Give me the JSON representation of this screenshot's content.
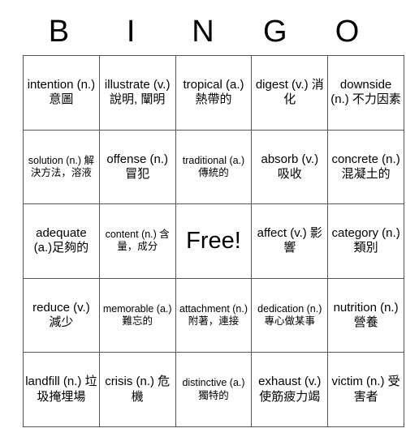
{
  "header": {
    "letters": [
      "B",
      "I",
      "N",
      "G",
      "O"
    ]
  },
  "grid": {
    "rows": 5,
    "columns": 5,
    "free_space": {
      "label": "Free!",
      "row": 3,
      "column": 3
    },
    "cells": [
      [
        {
          "term": "intention",
          "definition": "(n.) 意圖",
          "size": "normal"
        },
        {
          "term": "illustrate",
          "definition": "(v.) 說明, 闡明",
          "size": "normal"
        },
        {
          "term": "tropical",
          "definition": "(a.) 熱帶的",
          "size": "normal"
        },
        {
          "term": "digest",
          "definition": "(v.) 消化",
          "size": "normal"
        },
        {
          "term": "downside",
          "definition": "(n.) 不力因素",
          "size": "normal"
        }
      ],
      [
        {
          "term": "solution",
          "definition": "(n.) 解決方法，溶液",
          "size": "small"
        },
        {
          "term": "offense",
          "definition": "(n.) 冒犯",
          "size": "normal"
        },
        {
          "term": "traditional",
          "definition": "(a.) 傳統的",
          "size": "small"
        },
        {
          "term": "absorb",
          "definition": "(v.) 吸收",
          "size": "normal"
        },
        {
          "term": "concrete",
          "definition": "(n.) 混凝土的",
          "size": "normal"
        }
      ],
      [
        {
          "term": "adequate",
          "definition": "(a.)足夠的",
          "size": "normal"
        },
        {
          "term": "content",
          "definition": "(n.) 含量，成分",
          "size": "small"
        },
        {
          "term": "Free!",
          "definition": "",
          "size": "free"
        },
        {
          "term": "affect",
          "definition": "(v.) 影響",
          "size": "normal"
        },
        {
          "term": "category",
          "definition": "(n.) 類別",
          "size": "normal"
        }
      ],
      [
        {
          "term": "reduce",
          "definition": "(v.) 減少",
          "size": "normal"
        },
        {
          "term": "memorable",
          "definition": "(a.) 難忘的",
          "size": "small"
        },
        {
          "term": "attachment",
          "definition": "(n.) 附著，連接",
          "size": "small"
        },
        {
          "term": "dedication",
          "definition": "(n.) 專心做某事",
          "size": "small"
        },
        {
          "term": "nutrition",
          "definition": "(n.) 營養",
          "size": "normal"
        }
      ],
      [
        {
          "term": "landfill",
          "definition": "(n.) 垃圾掩埋場",
          "size": "normal"
        },
        {
          "term": "crisis",
          "definition": "(n.) 危機",
          "size": "normal"
        },
        {
          "term": "distinctive",
          "definition": "(a.) 獨特的",
          "size": "small"
        },
        {
          "term": "exhaust",
          "definition": "(v.) 使筋疲力竭",
          "size": "normal"
        },
        {
          "term": "victim",
          "definition": "(n.) 受害者",
          "size": "normal"
        }
      ]
    ]
  },
  "colors": {
    "background": "#ffffff",
    "text": "#000000",
    "grid_line": "#555555"
  }
}
